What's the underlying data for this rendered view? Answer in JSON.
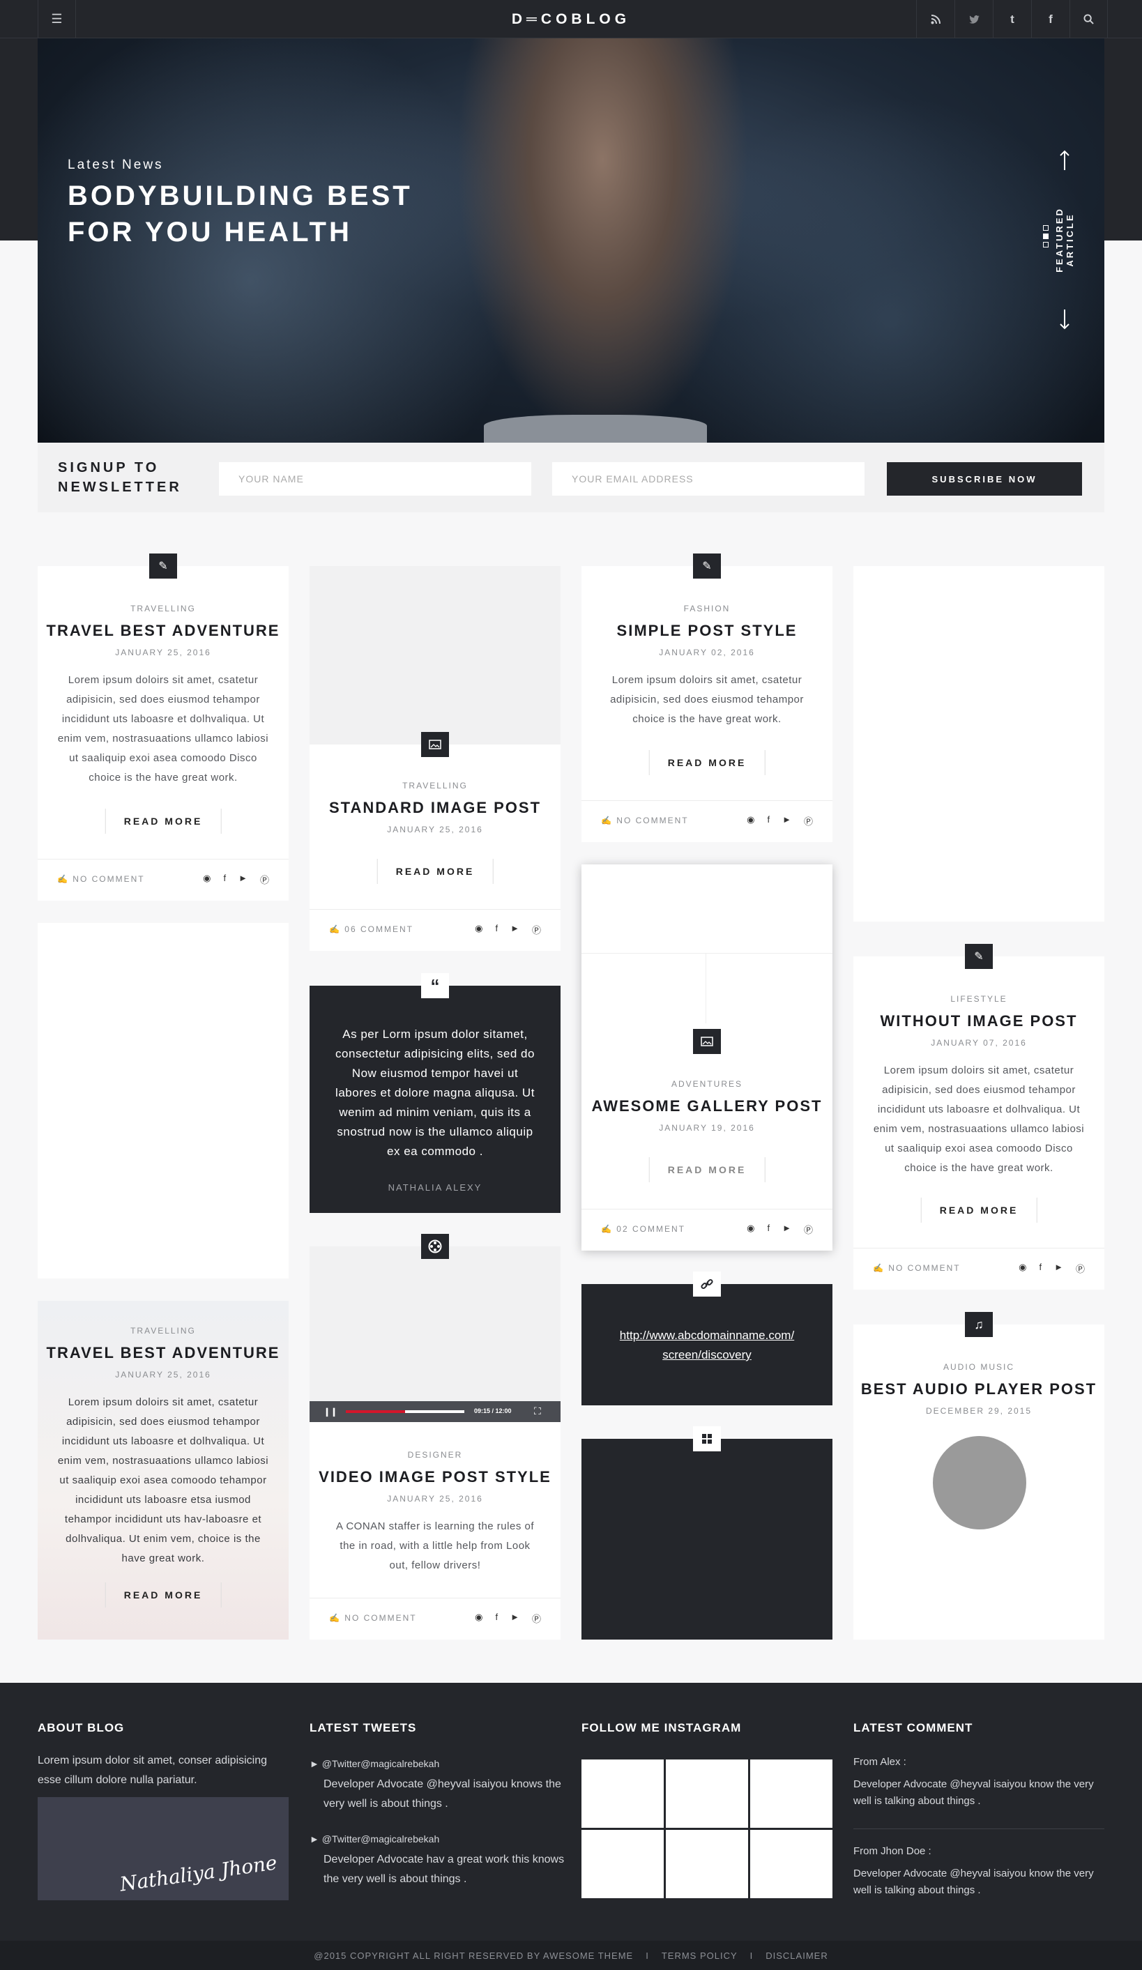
{
  "header": {
    "logo": "D═COBLOG",
    "menu_icon": "menu-icon",
    "icons": [
      "rss-icon",
      "twitter-icon",
      "tumblr-icon",
      "facebook-icon",
      "search-icon"
    ]
  },
  "hero": {
    "tag": "Latest News",
    "title_line1": "BODYBUILDING BEST",
    "title_line2": "FOR YOU HEALTH",
    "side_label": "FEATURED ARTICLE"
  },
  "newsletter": {
    "title_line1": "SIGNUP TO",
    "title_line2": "NEWSLETTER",
    "name_placeholder": "YOUR NAME",
    "email_placeholder": "YOUR EMAIL ADDRESS",
    "button": "SUBSCRIBE NOW"
  },
  "posts": {
    "read_more": "READ MORE",
    "no_comment": "NO COMMENT",
    "p1": {
      "category": "TRAVELLING",
      "title": "TRAVEL BEST ADVENTURE",
      "date": "JANUARY 25, 2016",
      "excerpt": "Lorem ipsum doloirs sit amet, csatetur adipisicin, sed does eiusmod tehampor incididunt uts laboasre et dolhvaliqua. Ut enim  vem, nostrasuaations ullamco labiosi ut saaliquip exoi asea comoodo Disco choice is the have great work."
    },
    "p2": {
      "category": "TRAVELLING",
      "title": "STANDARD IMAGE POST",
      "date": "JANUARY 25, 2016",
      "comments": "06 COMMENT"
    },
    "p3": {
      "category": "FASHION",
      "title": "SIMPLE POST STYLE",
      "date": "JANUARY 02, 2016",
      "excerpt": "Lorem ipsum doloirs sit amet, csatetur adipisicin, sed does eiusmod tehampor choice is the have great work."
    },
    "quote": {
      "text": "As per Lorm ipsum dolor sitamet, consectetur adipisicing elits, sed do Now eiusmod tempor havei ut labores et dolore magna aliqusa. Ut wenim ad minim veniam, quis its a snostrud now is the ullamco aliquip ex ea commodo .",
      "author": "NATHALIA ALEXY"
    },
    "gallery": {
      "category": "ADVENTURES",
      "title": "AWESOME GALLERY POST",
      "date": "JANUARY 19, 2016",
      "comments": "02 COMMENT"
    },
    "p4": {
      "category": "LIFESTYLE",
      "title": "WITHOUT IMAGE POST",
      "date": "JANUARY 07, 2016",
      "excerpt": "Lorem ipsum doloirs sit amet, csatetur adipisicin, sed does eiusmod tehampor incididunt uts laboasre et dolhvaliqua. Ut enim  vem, nostrasuaations ullamco labiosi ut saaliquip exoi asea comoodo Disco choice is the have great work."
    },
    "p5": {
      "category": "TRAVELLING",
      "title": "TRAVEL BEST ADVENTURE",
      "date": "JANUARY 25, 2016",
      "excerpt": "Lorem ipsum doloirs sit amet, csatetur adipisicin, sed does eiusmod tehampor incididunt uts laboasre et dolhvaliqua. Ut enim  vem, nostrasuaations ullamco labiosi ut saaliquip exoi asea comoodo tehampor incididunt uts laboasre etsa iusmod tehampor incididunt uts hav-laboasre et dolhvaliqua. Ut enim  vem, choice is the have great work."
    },
    "video": {
      "category": "DESIGNER",
      "title": "VIDEO IMAGE POST STYLE",
      "date": "JANUARY 25, 2016",
      "excerpt": "A CONAN staffer is learning the rules of the in  road, with a little help from Look out, fellow drivers!",
      "time": "09:15 / 12:00",
      "progress": 0.5
    },
    "link": {
      "line1": "http://www.abcdomainname.com/",
      "line2": "screen/discovery"
    },
    "audio": {
      "category": "AUDIO MUSIC",
      "title": "BEST AUDIO PLAYER POST",
      "date": "DECEMBER 29, 2015"
    }
  },
  "footer": {
    "about_title": "ABOUT BLOG",
    "about_text": "Lorem ipsum dolor sit amet, conser adipisicing esse cillum dolore nulla pariatur.",
    "signature": "Nathaliya Jhone",
    "tweets_title": "LATEST TWEETS",
    "tweets": [
      {
        "handle": "@Twitter@magicalrebekah",
        "text": "Developer Advocate @heyval isaiyou knows the very well is about things ."
      },
      {
        "handle": "@Twitter@magicalrebekah",
        "text": "Developer Advocate hav a great work this knows the very well is about things ."
      }
    ],
    "insta_title": "FOLLOW ME INSTAGRAM",
    "comment_title": "LATEST COMMENT",
    "comments": [
      {
        "from": "From Alex :",
        "text": "Developer Advocate @heyval isaiyou know the very well is talking about things ."
      },
      {
        "from": "From Jhon Doe :",
        "text": "Developer Advocate @heyval isaiyou know the very well is talking about things ."
      }
    ],
    "copyright": "@2015 COPYRIGHT  ALL RIGHT RESERVED BY AWESOME THEME",
    "terms": "TERMS POLICY",
    "disclaimer": "DISCLAIMER"
  }
}
